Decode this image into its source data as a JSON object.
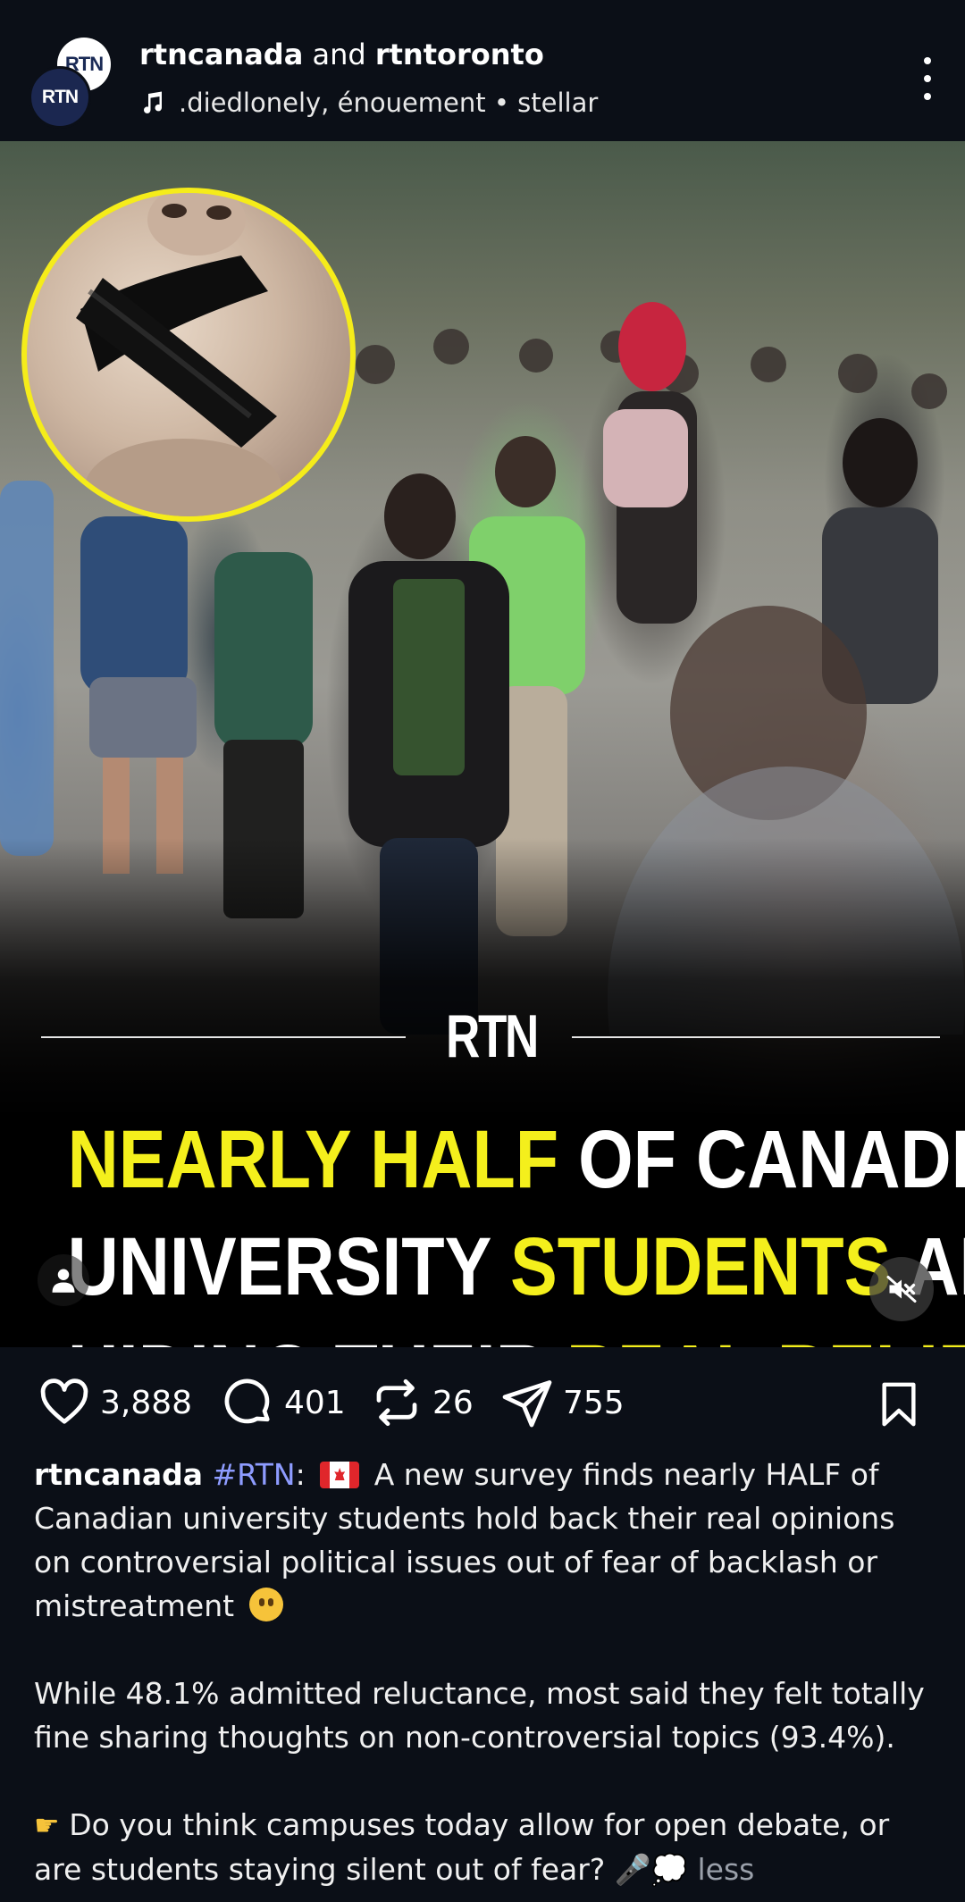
{
  "header": {
    "user1": "rtncanada",
    "and_word": "and",
    "user2": "rtntoronto",
    "avatar_back_text": "RTN",
    "avatar_front_text": "RTN",
    "audio": ".diedlonely, énouement • stellar"
  },
  "media": {
    "brand": "RTN",
    "headline": {
      "line1": [
        {
          "text": "NEARLY HALF ",
          "color": "yellow"
        },
        {
          "text": "OF CANADIAN",
          "color": "white"
        }
      ],
      "line2": [
        {
          "text": "UNIVERSITY ",
          "color": "white"
        },
        {
          "text": "STUDENTS ",
          "color": "yellow"
        },
        {
          "text": "ARE",
          "color": "white"
        }
      ],
      "line3": [
        {
          "text": "HIDING THEIR ",
          "color": "white"
        },
        {
          "text": "REAL BELIEFS",
          "color": "yellow"
        }
      ]
    },
    "accent_color": "#f4ef1c",
    "icons": [
      "tag-people-icon",
      "muted-speaker-icon"
    ]
  },
  "actions": {
    "likes": "3,888",
    "comments": "401",
    "reposts": "26",
    "shares": "755"
  },
  "caption": {
    "username": "rtncanada",
    "hashtag": "#RTN",
    "colon": ":",
    "p1": "A new survey finds nearly HALF of Canadian university students hold back their real opinions on controversial political issues out of fear of backlash or mistreatment",
    "p2": "While 48.1% admitted reluctance, most said they felt totally fine sharing thoughts on non-controversial topics (93.4%).",
    "p3": "Do you think campuses today allow for open debate, or are students staying silent out of fear?",
    "p3_emoji": "🎤💭",
    "less": "less"
  }
}
